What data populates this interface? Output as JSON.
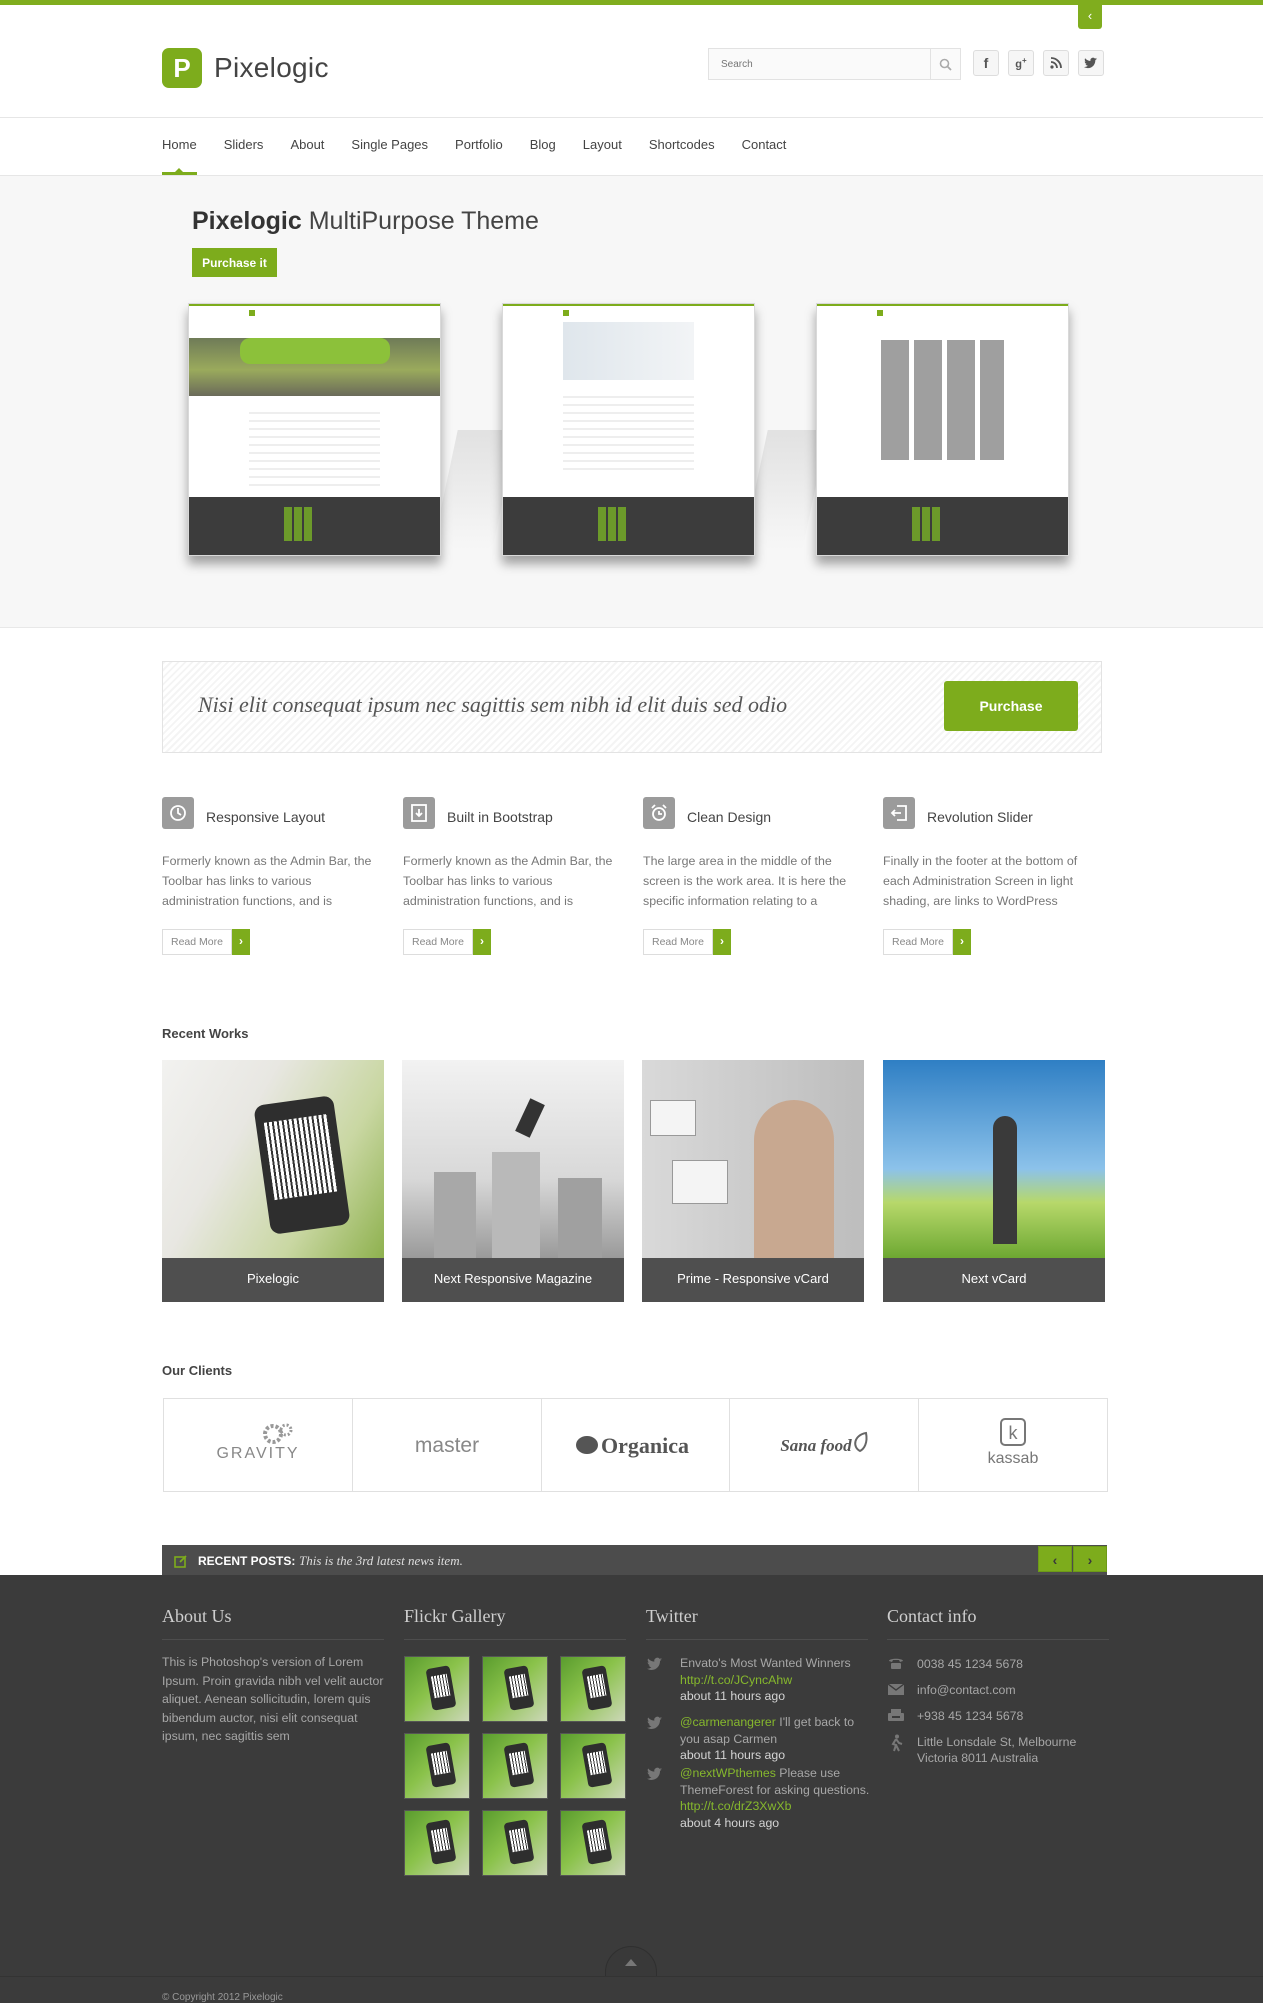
{
  "brand": {
    "logo_letter": "P",
    "name": "Pixelogic"
  },
  "header": {
    "search_placeholder": "Search",
    "corner_tab_icon": "‹"
  },
  "social": [
    {
      "icon": "f",
      "name": "facebook-icon"
    },
    {
      "icon": "g+",
      "name": "google-plus-icon"
    },
    {
      "icon": "rss",
      "name": "rss-icon"
    },
    {
      "icon": "twitter",
      "name": "twitter-icon"
    }
  ],
  "nav": {
    "items": [
      "Home",
      "Sliders",
      "About",
      "Single Pages",
      "Portfolio",
      "Blog",
      "Layout",
      "Shortcodes",
      "Contact"
    ],
    "active": "Home"
  },
  "hero": {
    "title_bold": "Pixelogic",
    "title_rest": " MultiPurpose Theme",
    "button": "Purchase it"
  },
  "promo": {
    "text": "Nisi elit consequat ipsum nec sagittis sem nibh id elit duis sed odio",
    "button": "Purchase"
  },
  "features": [
    {
      "title": "Responsive Layout",
      "desc": "Formerly known as the Admin Bar, the Toolbar has links to various administration functions, and is",
      "more": "Read More",
      "icon": "clock-icon"
    },
    {
      "title": "Built in Bootstrap",
      "desc": "Formerly known as the Admin Bar, the Toolbar has links to various administration functions, and is",
      "more": "Read More",
      "icon": "download-icon"
    },
    {
      "title": "Clean Design",
      "desc": "The large area in the middle of the screen is the work area. It is here the specific information relating to a",
      "more": "Read More",
      "icon": "alarm-icon"
    },
    {
      "title": "Revolution Slider",
      "desc": "Finally in the footer at the bottom of each Administration Screen in light shading, are links to WordPress",
      "more": "Read More",
      "icon": "exit-icon"
    }
  ],
  "recent_works": {
    "title": "Recent Works",
    "items": [
      "Pixelogic",
      "Next Responsive Magazine",
      "Prime - Responsive vCard",
      "Next vCard"
    ]
  },
  "clients": {
    "title": "Our Clients",
    "logos": [
      "GRAVITY",
      "master",
      "Organica",
      "Sana food",
      "kassab"
    ]
  },
  "recent_posts": {
    "label": "RECENT POSTS:",
    "text": "This is the 3rd latest news item."
  },
  "footer": {
    "about": {
      "title": "About Us",
      "text": "This is Photoshop's version of Lorem Ipsum. Proin gravida nibh vel velit auctor aliquet. Aenean sollicitudin, lorem quis bibendum auctor, nisi elit consequat ipsum, nec sagittis sem"
    },
    "flickr": {
      "title": "Flickr Gallery",
      "count": 9
    },
    "twitter": {
      "title": "Twitter",
      "tweets": [
        {
          "pre": "Envato's Most Wanted Winners ",
          "link": "http://t.co/JCyncAhw",
          "post": "",
          "time": "about 11 hours ago"
        },
        {
          "pre": "",
          "link": "@carmenangerer",
          "post": " I'll get back to you asap Carmen",
          "time": "about 11 hours ago"
        },
        {
          "pre": "",
          "link": "@nextWPthemes",
          "post": " Please use ThemeForest for asking questions. ",
          "link2": "http://t.co/drZ3XwXb",
          "time": "about 4 hours ago"
        }
      ]
    },
    "contact": {
      "title": "Contact info",
      "phone": "0038 45 1234 5678",
      "email": "info@contact.com",
      "fax": "+938 45 1234 5678",
      "address1": "Little Lonsdale St, Melbourne",
      "address2": "Victoria 8011 Australia"
    },
    "copyright": "© Copyright 2012 Pixelogic"
  },
  "colors": {
    "accent": "#7dac1c",
    "footer_bg": "#3b3b3b",
    "link": "#86b82d"
  }
}
